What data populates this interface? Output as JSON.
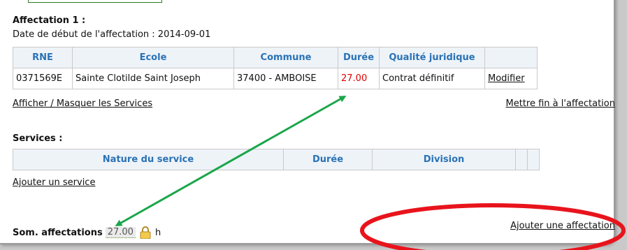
{
  "affectation": {
    "title": "Affectation 1 :",
    "date_line": "Date de début de l'affectation : 2014-09-01",
    "headers": [
      "RNE",
      "Ecole",
      "Commune",
      "Durée",
      "Qualité juridique",
      ""
    ],
    "row": {
      "rne": "0371569E",
      "ecole": "Sainte Clotilde Saint Joseph",
      "commune": "37400 - AMBOISE",
      "duree": "27.00",
      "qualite": "Contrat définitif",
      "modifier": "Modifier"
    },
    "toggle_services": "Afficher / Masquer les Services",
    "end_link": "Mettre fin à l'affectation"
  },
  "services": {
    "title": "Services :",
    "headers": [
      "Nature du service",
      "Durée",
      "Division"
    ],
    "add_link": "Ajouter un service"
  },
  "summary": {
    "label": "Som. affectations",
    "value": "27.00",
    "unit": "h"
  },
  "add_affectation": "Ajouter une affectation",
  "colors": {
    "header_text": "#2a72b5",
    "duree_value": "#e00000",
    "arrow": "#1aa64a",
    "ellipse": "#e8141c"
  },
  "icons": [
    "lock-icon"
  ]
}
